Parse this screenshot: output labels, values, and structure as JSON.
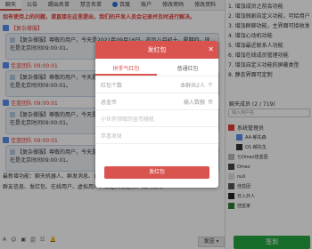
{
  "tabs": [
    {
      "label": "聊天"
    },
    {
      "label": "公告"
    },
    {
      "label": "踢出名单"
    },
    {
      "label": "禁言名单"
    },
    {
      "label": "百度"
    },
    {
      "label": "账户"
    },
    {
      "label": "修改密码"
    },
    {
      "label": "修改资料"
    }
  ],
  "chat": {
    "banner": "如有使用上的问题，请直接在这里提出，我们的开发人员会记录并及时进行解决。",
    "messages": [
      {
        "author": "【复杂撑服】"
      },
      {
        "author": "佳蓝团队 09:00:01"
      },
      {
        "author": "佳蓝团队 09:00:01"
      },
      {
        "author": "佳蓝团队 09:00:01"
      }
    ],
    "bubble_text": "【复杂撑服】尊敬的用户，今天是2021年09月16日，农历八月初十，星期四。现在是北京时间09:00:01。",
    "func_line1": "最新增功能：聊天机器人、群发消息、自定义功能、查看",
    "func_line2": "群友信息、发红包、在线用户、虚拟用户、自定义标题栏、图片发布"
  },
  "toolbar": [
    "A",
    "☺",
    "▣",
    "🗐",
    "☷",
    "🔔"
  ],
  "notice": [
    "1. 增加成员之前会功能",
    "2. 增加佩剧自定义功能，可给用户",
    "3. 增加群聊功能，主界面可接收发消息",
    "4. 增加心动机功能",
    "5. 增加最近联系人功能",
    "6. 增加在线成员管理功能",
    "7. 增加自定义功能的屏蔽类型",
    "8. 静态界面可定制"
  ],
  "users": {
    "header": "聊天成员 (2 / 719)",
    "search_placeholder": "输入用户名",
    "items": [
      {
        "name": "系统管理员",
        "kind": "head",
        "color": "#e53935"
      },
      {
        "name": "AA-郁先森",
        "kind": "item",
        "color": "#5b8def"
      },
      {
        "name": "O1-郁先生",
        "kind": "item",
        "color": "#333"
      },
      {
        "name": "七Omez佳蓝团",
        "kind": "item",
        "color": "#999"
      },
      {
        "name": "Omez",
        "kind": "item",
        "color": "#444"
      },
      {
        "name": "null",
        "kind": "item",
        "color": "#bbb"
      },
      {
        "name": "佳蓝团",
        "kind": "item",
        "color": "#333"
      },
      {
        "name": "日入外人",
        "kind": "item",
        "color": "#333"
      },
      {
        "name": "佳蓝家",
        "kind": "item",
        "color": "#2e7d32"
      }
    ]
  },
  "send_label": "发送",
  "sign_label": "签到",
  "modal": {
    "title": "发红包",
    "close": "✕",
    "tabs": [
      "拼手气红包",
      "普通红包"
    ],
    "count_label": "红包个数",
    "count_placeholder": "本群共2人",
    "count_unit": "个",
    "amount_label": "总金币",
    "amount_placeholder": "输入数额",
    "amount_unit": "币",
    "hint": "小伙伴领取的金币随机",
    "message_placeholder": "恭喜发财",
    "submit": "发红包"
  }
}
